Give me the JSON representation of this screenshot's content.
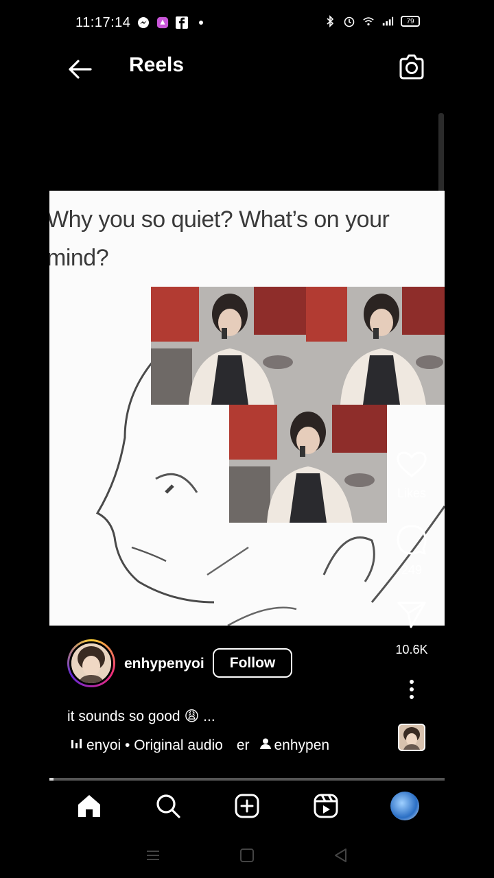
{
  "status_bar": {
    "time": "11:17:14",
    "battery": "79",
    "icons": [
      "messenger-icon",
      "app-icon",
      "facebook-icon",
      "dot-icon",
      "bluetooth-icon",
      "alarm-icon",
      "wifi-icon",
      "signal-icon"
    ]
  },
  "header": {
    "title": "Reels"
  },
  "reel": {
    "meme_text": "Why you so quiet? What's on your mind?",
    "meme_line1": "Why you so quiet? What’s on your",
    "meme_line2": "mind?"
  },
  "actions": {
    "likes_label": "Likes",
    "comments_count": "249",
    "shares_count": "10.6K"
  },
  "post": {
    "username": "enhypenyoi",
    "follow_label": "Follow",
    "caption": "it sounds so good 😩 ...",
    "audio_text": "enyoi • Original audio",
    "audio_trail": "er",
    "tagged_user": "enhypen"
  },
  "progress": 0.01,
  "colors": {
    "background": "#000000",
    "frame": "#fbfbfb",
    "story_ring": [
      "#f9ce34",
      "#ee2a7b",
      "#6228d7"
    ]
  },
  "bottom_nav": [
    "home-icon",
    "search-icon",
    "create-icon",
    "reels-icon",
    "profile-avatar"
  ]
}
